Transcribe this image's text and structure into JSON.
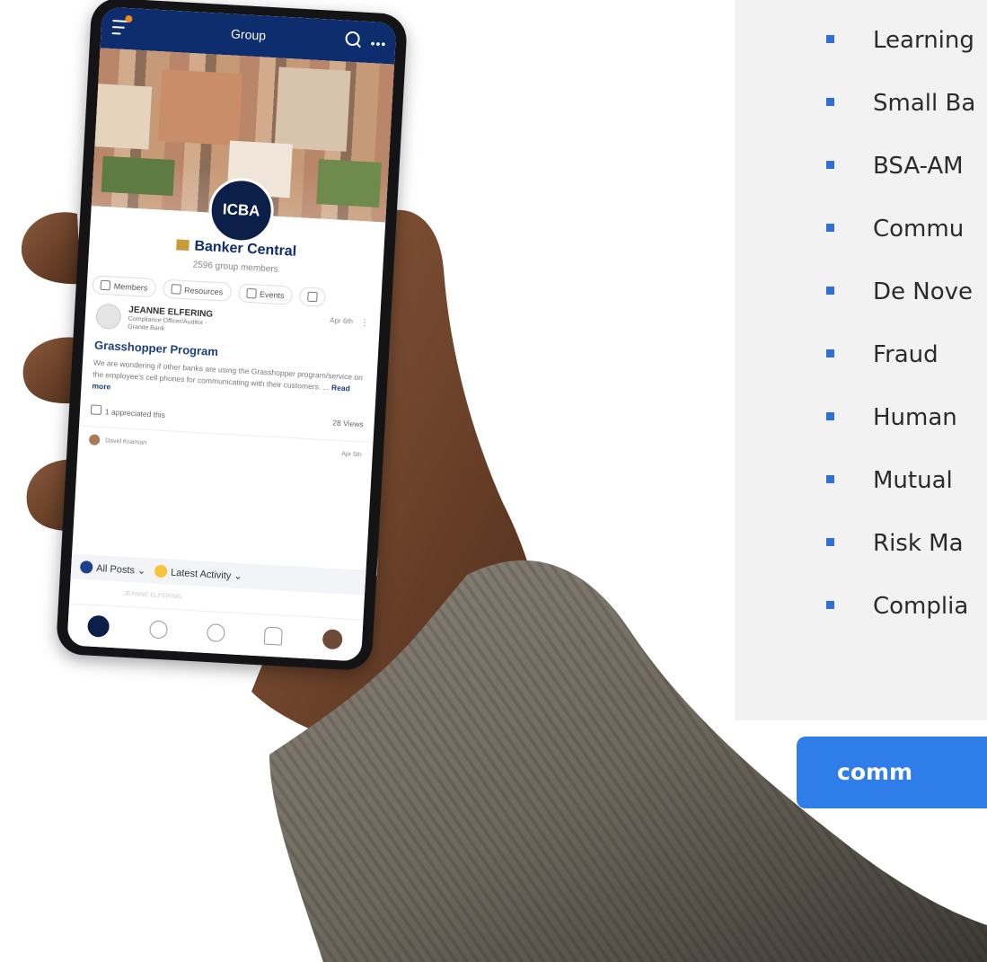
{
  "topics": [
    "Learning",
    "Small Ba",
    "BSA-AM",
    "Commu",
    "De Nove",
    "Fraud",
    "Human",
    "Mutual",
    "Risk Ma",
    "Complia"
  ],
  "cta_label": "comm",
  "colors": {
    "bullet": "#2f6fd6",
    "cta": "#2f7de8",
    "app_header": "#0e2d6e",
    "panel": "#f2f2f2"
  },
  "phone": {
    "header_title": "Group",
    "logo_text": "ICBA",
    "group_name": "Banker Central",
    "member_count": "2596 group members",
    "tabs": [
      "Members",
      "Resources",
      "Events"
    ],
    "post": {
      "author": "JEANNE ELFERING",
      "role": "Compliance Officer/Auditor - Granite Bank",
      "date": "Apr 6th",
      "title": "Grasshopper Program",
      "body": "We are wondering if other banks are using the Grasshopper program/service on the employee's cell phones for communicating with their customers. ...",
      "read_more": "Read more",
      "appreciated": "1 appreciated this",
      "views": "28 Views"
    },
    "next_author": "David Kraiman",
    "next_date": "Apr 5th",
    "filters": [
      "All Posts",
      "Latest Activity"
    ],
    "ghost_author": "JEANNE ELFERING",
    "nav_items": [
      "home-icon",
      "chat-icon",
      "add-icon",
      "bell-icon",
      "profile-icon"
    ]
  }
}
